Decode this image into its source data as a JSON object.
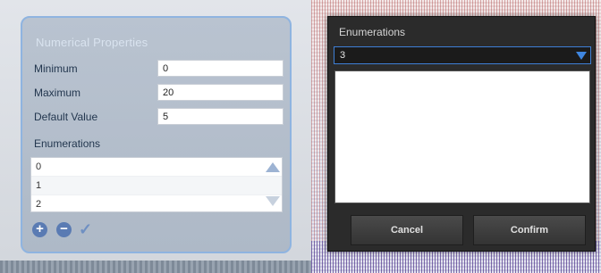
{
  "properties_panel": {
    "title": "Numerical Properties",
    "fields": [
      {
        "label": "Minimum",
        "value": "0"
      },
      {
        "label": "Maximum",
        "value": "20"
      },
      {
        "label": "Default Value",
        "value": "5"
      }
    ],
    "enumerations_label": "Enumerations",
    "enumerations": [
      "0",
      "1",
      "2"
    ],
    "add_icon": "plus-circle-icon",
    "remove_icon": "minus-circle-icon",
    "confirm_icon": "check-icon"
  },
  "enum_dialog": {
    "title": "Enumerations",
    "selected_value": "3",
    "cancel_label": "Cancel",
    "confirm_label": "Confirm"
  },
  "colors": {
    "panel_border": "#8fb4e0",
    "dialog_bg": "#2b2b2b",
    "accent_blue": "#3f86e0"
  }
}
